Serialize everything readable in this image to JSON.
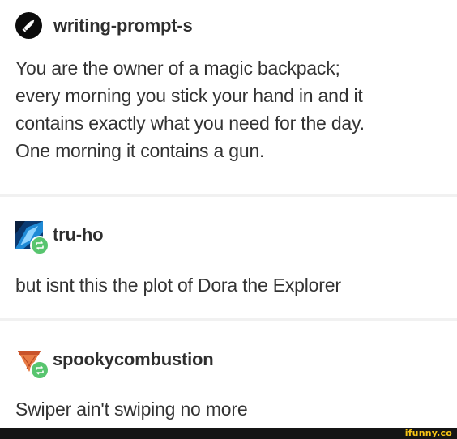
{
  "posts": [
    {
      "username": "writing-prompt-s",
      "lines": [
        "You are the owner of a magic backpack;",
        "every morning you stick your hand in and it",
        "contains exactly what you need for the day.",
        "One morning it contains a gun."
      ]
    },
    {
      "username": "tru-ho",
      "text": "but isnt this the plot of Dora the Explorer"
    },
    {
      "username": "spookycombustion",
      "text": "Swiper ain't swiping no more"
    }
  ],
  "watermark": "ifunny.co",
  "colors": {
    "reblog_badge": "#58c56f",
    "footer": "#151515",
    "watermark": "#f7c415"
  }
}
